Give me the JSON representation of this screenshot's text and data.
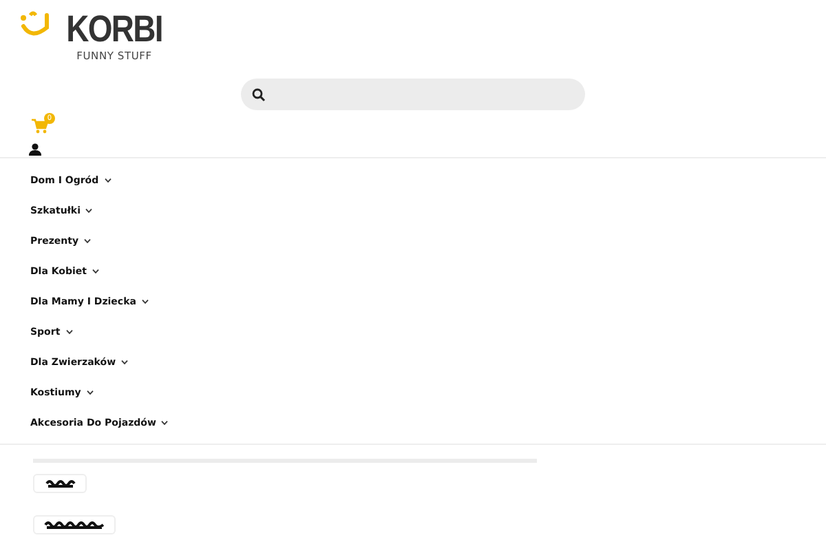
{
  "logo": {
    "name": "KORBI",
    "tagline": "FUNNY STUFF"
  },
  "cart": {
    "count": "0"
  },
  "menu": [
    {
      "label": "Dom I Ogród",
      "expandable": true
    },
    {
      "label": "Szkatułki",
      "expandable": true
    },
    {
      "label": "Prezenty",
      "expandable": true
    },
    {
      "label": "Dla Kobiet",
      "expandable": true
    },
    {
      "label": "Dla Mamy I Dziecka",
      "expandable": true
    },
    {
      "label": "Sport",
      "expandable": true
    },
    {
      "label": "Dla Zwierzaków",
      "expandable": true
    },
    {
      "label": "Kostiumy",
      "expandable": true
    },
    {
      "label": "Akcesoria Do Pojazdów",
      "expandable": true
    }
  ]
}
